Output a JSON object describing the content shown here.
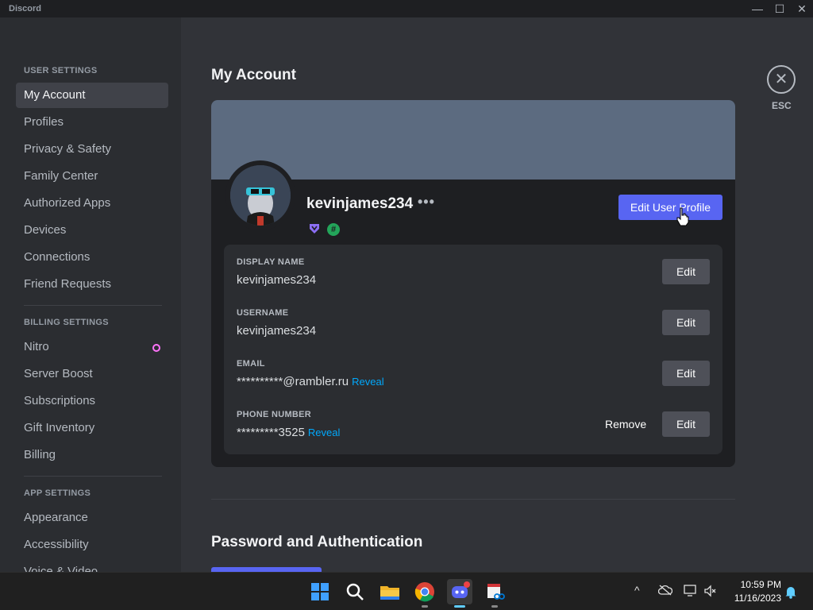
{
  "window": {
    "title": "Discord",
    "minimize_glyph": "—",
    "maximize_glyph": "☐",
    "close_glyph": "✕"
  },
  "sidebar": {
    "sections": [
      {
        "title": "USER SETTINGS",
        "items": [
          {
            "label": "My Account",
            "active": true
          },
          {
            "label": "Profiles"
          },
          {
            "label": "Privacy & Safety"
          },
          {
            "label": "Family Center"
          },
          {
            "label": "Authorized Apps"
          },
          {
            "label": "Devices"
          },
          {
            "label": "Connections"
          },
          {
            "label": "Friend Requests"
          }
        ]
      },
      {
        "title": "BILLING SETTINGS",
        "items": [
          {
            "label": "Nitro",
            "icon": "nitro-icon"
          },
          {
            "label": "Server Boost"
          },
          {
            "label": "Subscriptions"
          },
          {
            "label": "Gift Inventory"
          },
          {
            "label": "Billing"
          }
        ]
      },
      {
        "title": "APP SETTINGS",
        "items": [
          {
            "label": "Appearance"
          },
          {
            "label": "Accessibility"
          },
          {
            "label": "Voice & Video"
          }
        ]
      }
    ]
  },
  "main": {
    "title": "My Account",
    "close": {
      "glyph": "✕",
      "label": "ESC"
    },
    "profile": {
      "username": "kevinjames234",
      "more_glyph": "•••",
      "badges": [
        "nitro-badge-icon",
        "hash-badge-icon"
      ],
      "hash_glyph": "#",
      "edit_button": "Edit User Profile"
    },
    "fields": [
      {
        "label": "DISPLAY NAME",
        "value": "kevinjames234",
        "edit": "Edit"
      },
      {
        "label": "USERNAME",
        "value": "kevinjames234",
        "edit": "Edit"
      },
      {
        "label": "EMAIL",
        "value": "**********@rambler.ru",
        "reveal": "Reveal",
        "edit": "Edit"
      },
      {
        "label": "PHONE NUMBER",
        "value": "*********3525",
        "reveal": "Reveal",
        "remove": "Remove",
        "edit": "Edit"
      }
    ],
    "section2_title": "Password and Authentication"
  },
  "taskbar": {
    "apps": [
      "windows-start-icon",
      "search-icon",
      "file-explorer-icon",
      "chrome-icon",
      "discord-icon",
      "snipping-tool-icon"
    ],
    "tray": {
      "chevron": "^",
      "time": "10:59 PM",
      "date": "11/16/2023"
    }
  },
  "colors": {
    "accent": "#5865f2",
    "link": "#00a8fc",
    "sidebar_bg": "#2b2d31",
    "main_bg": "#313338"
  }
}
